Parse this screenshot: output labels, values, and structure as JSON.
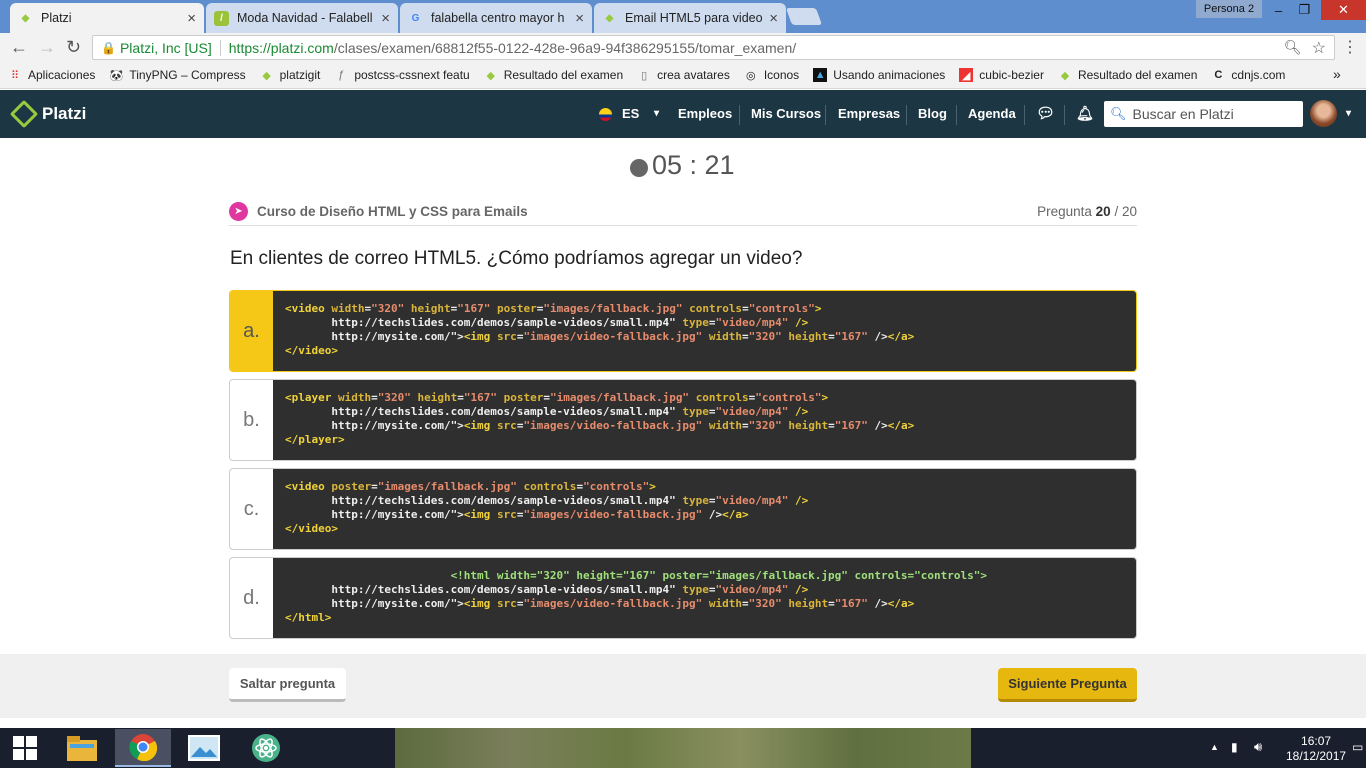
{
  "browser": {
    "tabs": [
      {
        "title": "Platzi",
        "icon": "platzi-favicon",
        "active": true
      },
      {
        "title": "Moda Navidad - Falabell",
        "icon": "falabella-favicon"
      },
      {
        "title": "falabella centro mayor h",
        "icon": "google-favicon"
      },
      {
        "title": "Email HTML5 para video",
        "icon": "platzi-favicon"
      }
    ],
    "profile": "Persona 2",
    "window_controls": {
      "minimize": "–",
      "maximize": "❐",
      "close": "✕"
    },
    "secure_label": "Platzi, Inc [US]",
    "url_host": "https://platzi.com",
    "url_path": "/clases/examen/68812f55-0122-428e-96a9-94f386295155/tomar_examen/",
    "bookmarks": [
      {
        "label": "Aplicaciones",
        "icon": "apps-grid-icon"
      },
      {
        "label": "TinyPNG – Compress",
        "icon": "panda-icon"
      },
      {
        "label": "platzigit",
        "icon": "platzi-favicon"
      },
      {
        "label": "postcss-cssnext featu",
        "icon": "postcss-icon"
      },
      {
        "label": "Resultado del examen",
        "icon": "platzi-favicon"
      },
      {
        "label": "crea avatares",
        "icon": "page-icon"
      },
      {
        "label": "Iconos",
        "icon": "binoculars-icon"
      },
      {
        "label": "Usando animaciones",
        "icon": "mdn-icon"
      },
      {
        "label": "cubic-bezier",
        "icon": "cubic-bezier-icon"
      },
      {
        "label": "Resultado del examen",
        "icon": "platzi-favicon"
      },
      {
        "label": "cdnjs.com",
        "icon": "cdnjs-icon"
      }
    ],
    "bookmarks_overflow": "»"
  },
  "header": {
    "logo": "Platzi",
    "lang": "ES",
    "nav": [
      "Empleos",
      "Mis Cursos",
      "Empresas",
      "Blog",
      "Agenda"
    ],
    "search_placeholder": "Buscar en Platzi"
  },
  "exam": {
    "timer": "05 : 21",
    "course_name": "Curso de Diseño HTML y CSS para Emails",
    "question_label": "Pregunta",
    "question_current": "20",
    "question_total": "/ 20",
    "question_text": "En clientes de correo HTML5. ¿Cómo podríamos agregar un video?",
    "options": [
      {
        "letter": "a.",
        "selected": true,
        "lines": [
          "<video width=\"320\" height=\"167\" poster=\"images/fallback.jpg\" controls=\"controls\">",
          "       http://techslides.com/demos/sample-videos/small.mp4\" type=\"video/mp4\" />",
          "       http://mysite.com/\"><img src=\"images/video-fallback.jpg\" width=\"320\" height=\"167\" /></a>",
          "</video>"
        ]
      },
      {
        "letter": "b.",
        "selected": false,
        "lines": [
          "<player width=\"320\" height=\"167\" poster=\"images/fallback.jpg\" controls=\"controls\">",
          "       http://techslides.com/demos/sample-videos/small.mp4\" type=\"video/mp4\" />",
          "       http://mysite.com/\"><img src=\"images/video-fallback.jpg\" width=\"320\" height=\"167\" /></a>",
          "</player>"
        ]
      },
      {
        "letter": "c.",
        "selected": false,
        "lines": [
          "<video poster=\"images/fallback.jpg\" controls=\"controls\">",
          "       http://techslides.com/demos/sample-videos/small.mp4\" type=\"video/mp4\" />",
          "       http://mysite.com/\"><img src=\"images/video-fallback.jpg\" /></a>",
          "</video>"
        ]
      },
      {
        "letter": "d.",
        "selected": false,
        "lines": [
          "                         <!html width=\"320\" height=\"167\" poster=\"images/fallback.jpg\" controls=\"controls\">",
          "       http://techslides.com/demos/sample-videos/small.mp4\" type=\"video/mp4\" />",
          "       http://mysite.com/\"><img src=\"images/video-fallback.jpg\" width=\"320\" height=\"167\" /></a>",
          "</html>"
        ]
      }
    ],
    "skip_label": "Saltar pregunta",
    "next_label": "Siguiente Pregunta"
  },
  "taskbar": {
    "time": "16:07",
    "date": "18/12/2017",
    "apps": [
      "windows-start-icon",
      "file-explorer-icon",
      "chrome-icon",
      "photos-icon",
      "atom-icon"
    ]
  },
  "colors": {
    "header_bg": "#1c3643",
    "accent": "#f5c818",
    "platzi_green": "#98ca3f",
    "next_button": "#e6b70e"
  }
}
